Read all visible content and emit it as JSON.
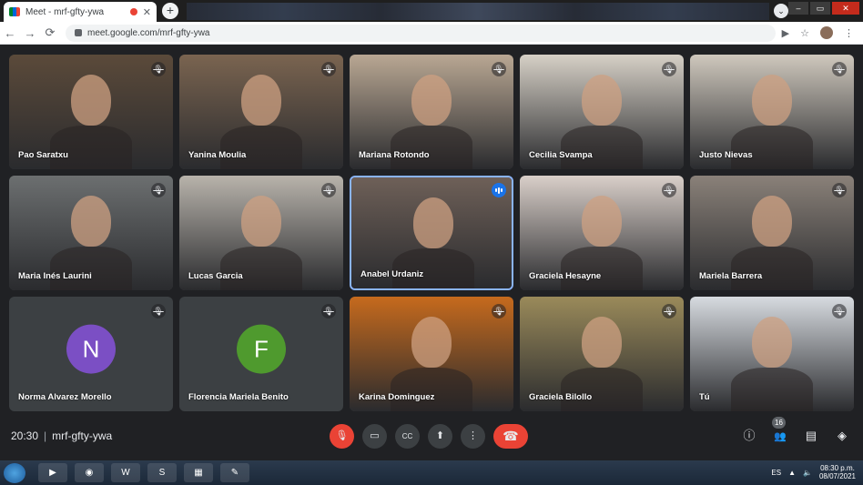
{
  "browser": {
    "tab_title": "Meet - mrf-gfty-ywa",
    "tab_close": "✕",
    "new_tab": "+",
    "url": "meet.google.com/mrf-gfty-ywa",
    "back": "←",
    "forward": "→",
    "reload": "⟳",
    "menu": "⋮",
    "camera": "▶",
    "star": "☆"
  },
  "meeting": {
    "time": "20:30",
    "separator": "|",
    "code": "mrf-gfty-ywa",
    "participant_count": "16"
  },
  "participants": [
    {
      "name": "Pao Saratxu",
      "muted": true,
      "bg": "#5b4a3a"
    },
    {
      "name": "Yanina Moulia",
      "muted": true,
      "bg": "#7a6450"
    },
    {
      "name": "Mariana Rotondo",
      "muted": true,
      "bg": "#b9a793"
    },
    {
      "name": "Cecilia Svampa",
      "muted": true,
      "bg": "#d6d0c6"
    },
    {
      "name": "Justo Nievas",
      "muted": true,
      "bg": "#cfc8bd"
    },
    {
      "name": "Maria Inés Laurini",
      "muted": true,
      "bg": "#6c6f70"
    },
    {
      "name": "Lucas Garcia",
      "muted": true,
      "bg": "#b8b3ab"
    },
    {
      "name": "Anabel Urdaniz",
      "muted": false,
      "bg": "#6e6058"
    },
    {
      "name": "Graciela Hesayne",
      "muted": true,
      "bg": "#d9cfc9"
    },
    {
      "name": "Mariela Barrera",
      "muted": true,
      "bg": "#8a8179"
    },
    {
      "name": "Norma Alvarez Morello",
      "muted": true,
      "initial": "N",
      "avatar_color": "#7b4fc4"
    },
    {
      "name": "Florencia Mariela Benito",
      "muted": true,
      "initial": "F",
      "avatar_color": "#4f9a2e"
    },
    {
      "name": "Karina Dominguez",
      "muted": true,
      "bg": "#c66a1d"
    },
    {
      "name": "Graciela Bilollo",
      "muted": true,
      "bg": "#9a8a5a"
    },
    {
      "name": "Tú",
      "muted": true,
      "bg": "#d7dbe0"
    }
  ],
  "icons": {
    "mic_off": "mic-off-icon",
    "camera": "camera-icon",
    "captions": "captions-icon",
    "present": "present-icon",
    "more": "more-options-icon",
    "hangup": "hangup-icon",
    "info": "info-icon",
    "people": "people-icon",
    "chat": "chat-icon",
    "activities": "activities-icon"
  },
  "glyphs": {
    "mute": "🎙",
    "info": "ⓘ",
    "people": "👥",
    "chat": "▤",
    "activities": "◈",
    "camera": "▭",
    "captions": "CC",
    "present": "⬆",
    "more": "⋮",
    "hangup": "☎"
  },
  "taskbar": {
    "lang": "ES",
    "time": "08:30 p.m.",
    "date": "08/07/2021",
    "apps": [
      "▶",
      "◉",
      "W",
      "S",
      "▦",
      "✎"
    ]
  },
  "colors": {
    "bg": "#202124",
    "tile": "#3c4043",
    "active_border": "#8ab4f8",
    "hangup": "#ea4335"
  }
}
